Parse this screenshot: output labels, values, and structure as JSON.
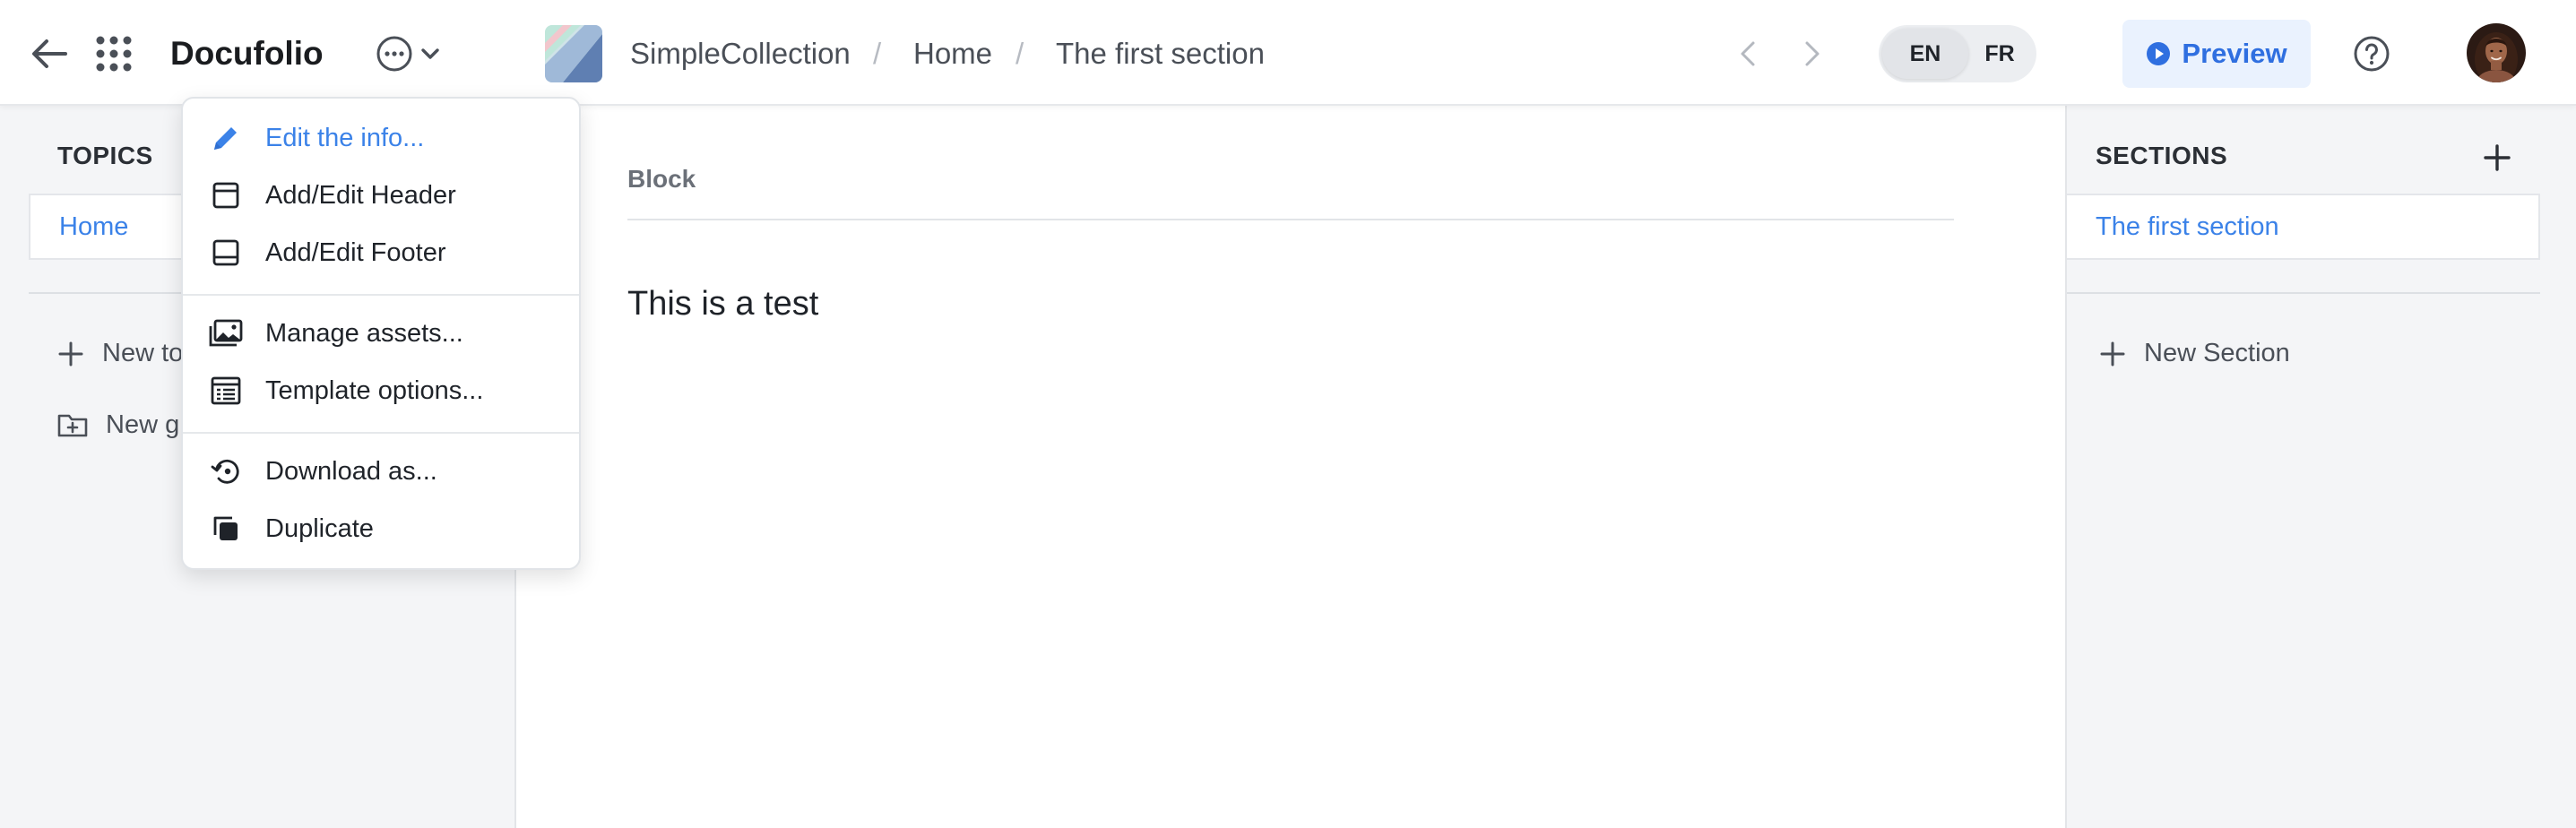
{
  "app": {
    "name": "Docufolio"
  },
  "breadcrumb": {
    "collection": "SimpleCollection",
    "separator": "/",
    "topic": "Home",
    "section": "The first section"
  },
  "language": {
    "options": [
      "EN",
      "FR"
    ],
    "selected": "EN"
  },
  "toolbar": {
    "preview_label": "Preview"
  },
  "left_panel": {
    "heading": "TOPICS",
    "topics": [
      "Home"
    ],
    "selected_topic": "Home",
    "new_topic_label": "New topic",
    "new_group_label": "New group"
  },
  "main": {
    "block_label": "Block",
    "block_text": "This is a test"
  },
  "right_panel": {
    "heading": "SECTIONS",
    "sections": [
      "The first section"
    ],
    "new_section_label": "New Section"
  },
  "menu": {
    "items": [
      {
        "label": "Edit the info...",
        "icon": "pencil-icon"
      },
      {
        "label": "Add/Edit Header",
        "icon": "header-layout-icon"
      },
      {
        "label": "Add/Edit Footer",
        "icon": "footer-layout-icon"
      },
      {
        "label": "Manage assets...",
        "icon": "images-icon"
      },
      {
        "label": "Template options...",
        "icon": "template-list-icon"
      },
      {
        "label": "Download as...",
        "icon": "download-history-icon"
      },
      {
        "label": "Duplicate",
        "icon": "duplicate-icon"
      }
    ]
  },
  "colors": {
    "accent": "#3b82e8",
    "preview_bg": "#eaf2fe",
    "panel_bg": "#f4f5f7"
  }
}
